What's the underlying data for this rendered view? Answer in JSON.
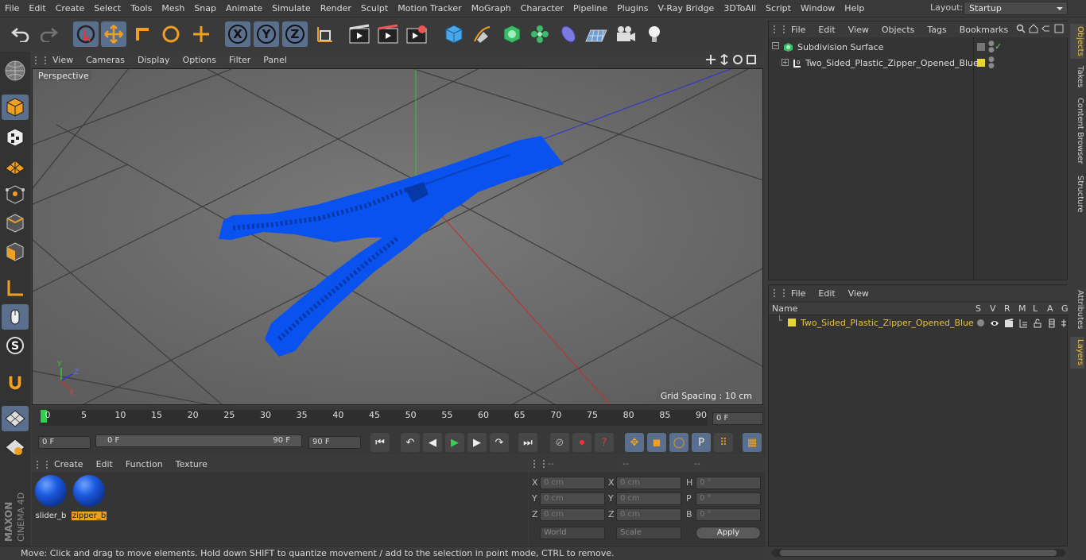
{
  "menubar": {
    "items": [
      "File",
      "Edit",
      "Create",
      "Select",
      "Tools",
      "Mesh",
      "Snap",
      "Animate",
      "Simulate",
      "Render",
      "Sculpt",
      "Motion Tracker",
      "MoGraph",
      "Character",
      "Pipeline",
      "Plugins",
      "V-Ray Bridge",
      "3DToAll",
      "Script",
      "Window",
      "Help"
    ],
    "layout_label": "Layout:",
    "layout_value": "Startup"
  },
  "toolbar": {
    "axis_labels": [
      "X",
      "Y",
      "Z"
    ]
  },
  "viewport": {
    "menu": [
      "View",
      "Cameras",
      "Display",
      "Options",
      "Filter",
      "Panel"
    ],
    "camera_label": "Perspective",
    "grid_spacing": "Grid Spacing : 10 cm",
    "axis_x": "X",
    "axis_y": "Y",
    "axis_z": "Z",
    "model_color": "#0a52f0"
  },
  "timeline": {
    "ticks": [
      "0",
      "5",
      "10",
      "15",
      "20",
      "25",
      "30",
      "35",
      "40",
      "45",
      "50",
      "55",
      "60",
      "65",
      "70",
      "75",
      "80",
      "85",
      "90"
    ],
    "current_frame": "0 F"
  },
  "transport": {
    "start_field": "0 F",
    "range_start": "0 F",
    "range_end": "90 F",
    "end_field": "90 F"
  },
  "materials": {
    "menu": [
      "Create",
      "Edit",
      "Function",
      "Texture"
    ],
    "items": [
      {
        "name": "slider_b",
        "selected": false
      },
      {
        "name": "zipper_b",
        "selected": true
      }
    ]
  },
  "coords": {
    "headers": [
      "--",
      "--",
      "--"
    ],
    "rows": [
      {
        "a": "X",
        "av": "0 cm",
        "b": "X",
        "bv": "0 cm",
        "c": "H",
        "cv": "0 °"
      },
      {
        "a": "Y",
        "av": "0 cm",
        "b": "Y",
        "bv": "0 cm",
        "c": "P",
        "cv": "0 °"
      },
      {
        "a": "Z",
        "av": "0 cm",
        "b": "Z",
        "bv": "0 cm",
        "c": "B",
        "cv": "0 °"
      }
    ],
    "mode": "World",
    "scale": "Scale",
    "apply": "Apply"
  },
  "status": "Move: Click and drag to move elements. Hold down SHIFT to quantize movement / add to the selection in point mode, CTRL to remove.",
  "objects": {
    "menu": [
      "File",
      "Edit",
      "View",
      "Objects",
      "Tags",
      "Bookmarks"
    ],
    "items": [
      "Subdivision Surface",
      "Two_Sided_Plastic_Zipper_Opened_Blue"
    ]
  },
  "layers": {
    "menu": [
      "File",
      "Edit",
      "View"
    ],
    "columns": [
      "Name",
      "S",
      "V",
      "R",
      "M",
      "L",
      "A",
      "G"
    ],
    "row": "Two_Sided_Plastic_Zipper_Opened_Blue",
    "accent": "#e8c23a"
  },
  "sidetabs": [
    "Objects",
    "Takes",
    "Content Browser",
    "Structure",
    "Attributes",
    "Layers"
  ],
  "brand": {
    "line1": "MAXON",
    "line2": "CINEMA 4D"
  }
}
